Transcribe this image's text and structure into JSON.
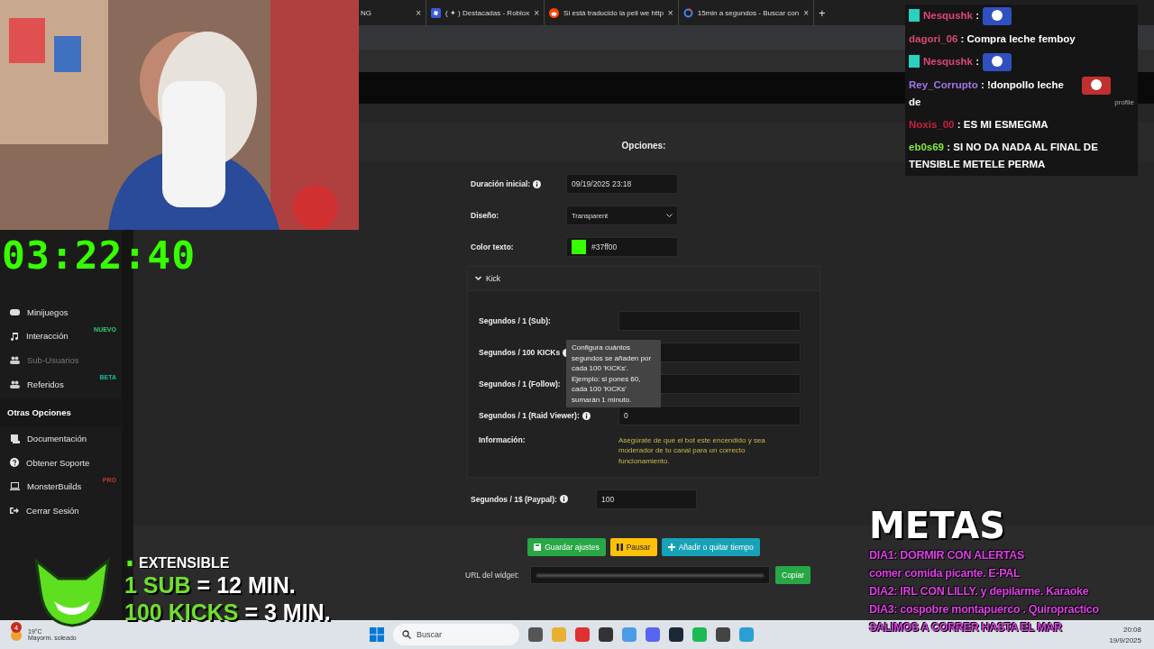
{
  "browser": {
    "tabs": [
      {
        "title": "NG",
        "close": "×",
        "selected": false
      },
      {
        "title": "( ✦ ) Destacadas - Roblox",
        "close": "×",
        "selected": false
      },
      {
        "title": "Si está traducido la peli we http",
        "close": "×",
        "selected": false
      },
      {
        "title": "15min a segundos - Buscar con",
        "close": "×",
        "selected": false
      }
    ],
    "new_tab": "+"
  },
  "sidebar": {
    "items": [
      {
        "label": "Minijuegos",
        "disabled": false
      },
      {
        "label": "Interacción",
        "disabled": false,
        "badge": "NUEVO",
        "color": "#2ecc71"
      },
      {
        "label": "Sub-Usuarios",
        "disabled": true
      },
      {
        "label": "Referidos",
        "disabled": false,
        "badge": "BETA",
        "color": "#1abc9c"
      }
    ],
    "section": "Otras Opciones",
    "other_items": [
      {
        "label": "Documentación",
        "disabled": false
      },
      {
        "label": "Obtener Soporte",
        "disabled": false
      },
      {
        "label": "MonsterBuilds",
        "disabled": false,
        "badge": "PRO",
        "color": "#c0392b"
      },
      {
        "label": "Cerrar Sesión",
        "disabled": false
      }
    ]
  },
  "options": {
    "title": "Opciones:",
    "rows": [
      {
        "kind": "input",
        "label": "Duración inicial:",
        "info": true,
        "value": "09/19/2025 23:18"
      },
      {
        "kind": "select",
        "label": "Diseño:",
        "info": false,
        "value": "Transparent"
      },
      {
        "kind": "color",
        "label": "Color texto:",
        "info": false,
        "value": "#37ff00",
        "color": "#37ff00"
      }
    ],
    "kick": {
      "title": "Kick",
      "expanded": true,
      "rows": [
        {
          "label": "Segundos / 1 (Sub):",
          "info": false
        },
        {
          "label": "Segundos / 100 KICKs",
          "info": true
        },
        {
          "label": "Segundos / 1 (Follow):",
          "info": false
        },
        {
          "label": "Segundos / 1 (Raid Viewer):",
          "info": true,
          "value": "0"
        }
      ],
      "info_label": "Información:",
      "info_text": "Asegúrate de que el bot este encendido y sea moderador de tu canal para un correcto funcionamiento.",
      "tooltip": "Configura cuántos segundos se añaden por cada 100 'KICKs'. Ejemplo: si pones 60, cada 100 'KICKs' sumarán 1 minuto."
    },
    "paypal": {
      "label": "Segundos / 1$ (Paypal):",
      "value": "100"
    },
    "buttons": [
      {
        "label": "Guardar ajustes",
        "color": "#28a745"
      },
      {
        "label": "Pausar",
        "color": "#ffc107"
      },
      {
        "label": "Añadir o quitar tiempo",
        "color": "#17a2b8"
      }
    ],
    "url": {
      "label": "URL del widget:",
      "button": "Copiar"
    }
  },
  "overlay": {
    "timer": "03:22:40",
    "chat": [
      {
        "user": "Nesqushk",
        "color": "#e0457b",
        "text": ":",
        "badge": true,
        "emote": true
      },
      {
        "user": "dagori_06",
        "color": "#d64a6e",
        "text": ": Compra leche femboy",
        "badge": false,
        "emote": false
      },
      {
        "user": "Nesqushk",
        "color": "#e0457b",
        "text": ":",
        "badge": true,
        "emote": true
      },
      {
        "user": "Rey_Corrupto",
        "color": "#a275e8",
        "text": ": !donpollo leche de",
        "badge": false,
        "emote": true
      },
      {
        "user": "Noxis_00",
        "color": "#c8203f",
        "text": ": ES MI ESMEGMA",
        "badge": false,
        "emote": false
      },
      {
        "user": "eb0s69",
        "color": "#86e840",
        "text": ": SI NO DA NADA AL FINAL DE TENSIBLE METELE PERMA",
        "badge": false,
        "emote": false
      }
    ],
    "chat_profile": "profile",
    "metas": {
      "title": "METAS",
      "lines": [
        "DIA1: DORMIR CON ALERTAS",
        "comer comida picante. E-PAL",
        "DIA2: IRL CON LILLY. y depilarme. Karaoke",
        "DIA3: cospobre montapuerco . Quiropractico",
        "SALIMOS A CORRER HASTA EL MAR"
      ]
    },
    "extensible": {
      "title": "EXTENSIBLE",
      "lines": [
        {
          "highlight": "1 SUB",
          "rest": "= 12 MIN."
        },
        {
          "highlight": "100 KICKS",
          "rest": "= 3 MIN."
        }
      ]
    }
  },
  "taskbar": {
    "weather": {
      "temp": "19°C",
      "text": "Mayorm. soleado",
      "badge": "4"
    },
    "search": "Buscar",
    "time": "20:08",
    "date": "19/9/2025"
  }
}
